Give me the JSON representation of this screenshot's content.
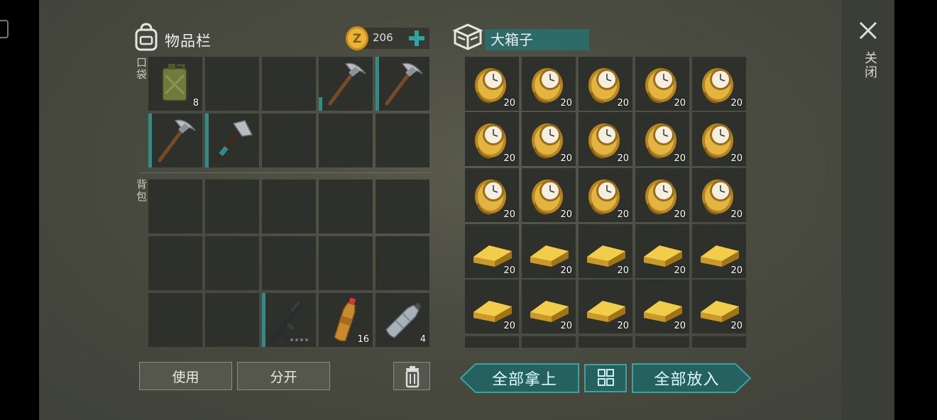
{
  "inventory": {
    "title": "物品栏",
    "pockets_label": "口袋",
    "backpack_label": "背包",
    "coins": "206",
    "pockets": [
      {
        "item": "jerry-can",
        "count": "8",
        "durability": 0
      },
      {
        "item": "empty",
        "count": "",
        "durability": 0
      },
      {
        "item": "empty",
        "count": "",
        "durability": 0
      },
      {
        "item": "pickaxe",
        "count": "",
        "durability": 0.25
      },
      {
        "item": "pickaxe",
        "count": "",
        "durability": 1
      },
      {
        "item": "pickaxe",
        "count": "",
        "durability": 1
      },
      {
        "item": "hatchet",
        "count": "",
        "durability": 1
      },
      {
        "item": "empty",
        "count": "",
        "durability": 0
      },
      {
        "item": "empty",
        "count": "",
        "durability": 0
      },
      {
        "item": "empty",
        "count": "",
        "durability": 0
      }
    ],
    "backpack": [
      {
        "item": "empty",
        "count": "",
        "durability": 0
      },
      {
        "item": "empty",
        "count": "",
        "durability": 0
      },
      {
        "item": "empty",
        "count": "",
        "durability": 0
      },
      {
        "item": "empty",
        "count": "",
        "durability": 0
      },
      {
        "item": "empty",
        "count": "",
        "durability": 0
      },
      {
        "item": "empty",
        "count": "",
        "durability": 0
      },
      {
        "item": "empty",
        "count": "",
        "durability": 0
      },
      {
        "item": "empty",
        "count": "",
        "durability": 0
      },
      {
        "item": "empty",
        "count": "",
        "durability": 0
      },
      {
        "item": "empty",
        "count": "",
        "durability": 0
      },
      {
        "item": "empty",
        "count": "",
        "durability": 0
      },
      {
        "item": "empty",
        "count": "",
        "durability": 0
      },
      {
        "item": "assault-rifle",
        "count": "",
        "durability": 1
      },
      {
        "item": "soda-bottle",
        "count": "16",
        "durability": 0
      },
      {
        "item": "water-bottle",
        "count": "4",
        "durability": 0
      }
    ],
    "use_button": "使用",
    "split_button": "分开"
  },
  "chest": {
    "title": "大箱子",
    "slots": [
      {
        "item": "gold-watch",
        "count": "20"
      },
      {
        "item": "gold-watch",
        "count": "20"
      },
      {
        "item": "gold-watch",
        "count": "20"
      },
      {
        "item": "gold-watch",
        "count": "20"
      },
      {
        "item": "gold-watch",
        "count": "20"
      },
      {
        "item": "gold-watch",
        "count": "20"
      },
      {
        "item": "gold-watch",
        "count": "20"
      },
      {
        "item": "gold-watch",
        "count": "20"
      },
      {
        "item": "gold-watch",
        "count": "20"
      },
      {
        "item": "gold-watch",
        "count": "20"
      },
      {
        "item": "gold-watch",
        "count": "20"
      },
      {
        "item": "gold-watch",
        "count": "20"
      },
      {
        "item": "gold-watch",
        "count": "20"
      },
      {
        "item": "gold-watch",
        "count": "20"
      },
      {
        "item": "gold-watch",
        "count": "20"
      },
      {
        "item": "gold-bar",
        "count": "20"
      },
      {
        "item": "gold-bar",
        "count": "20"
      },
      {
        "item": "gold-bar",
        "count": "20"
      },
      {
        "item": "gold-bar",
        "count": "20"
      },
      {
        "item": "gold-bar",
        "count": "20"
      },
      {
        "item": "gold-bar",
        "count": "20"
      },
      {
        "item": "gold-bar",
        "count": "20"
      },
      {
        "item": "gold-bar",
        "count": "20"
      },
      {
        "item": "gold-bar",
        "count": "20"
      },
      {
        "item": "gold-bar",
        "count": "20"
      }
    ],
    "take_all_button": "全部拿上",
    "put_all_button": "全部放入"
  },
  "close_label": "关闭",
  "colors": {
    "accent_teal": "#2d6b68",
    "gold": "#d8a52a",
    "slot_bg": "#2e302b"
  }
}
